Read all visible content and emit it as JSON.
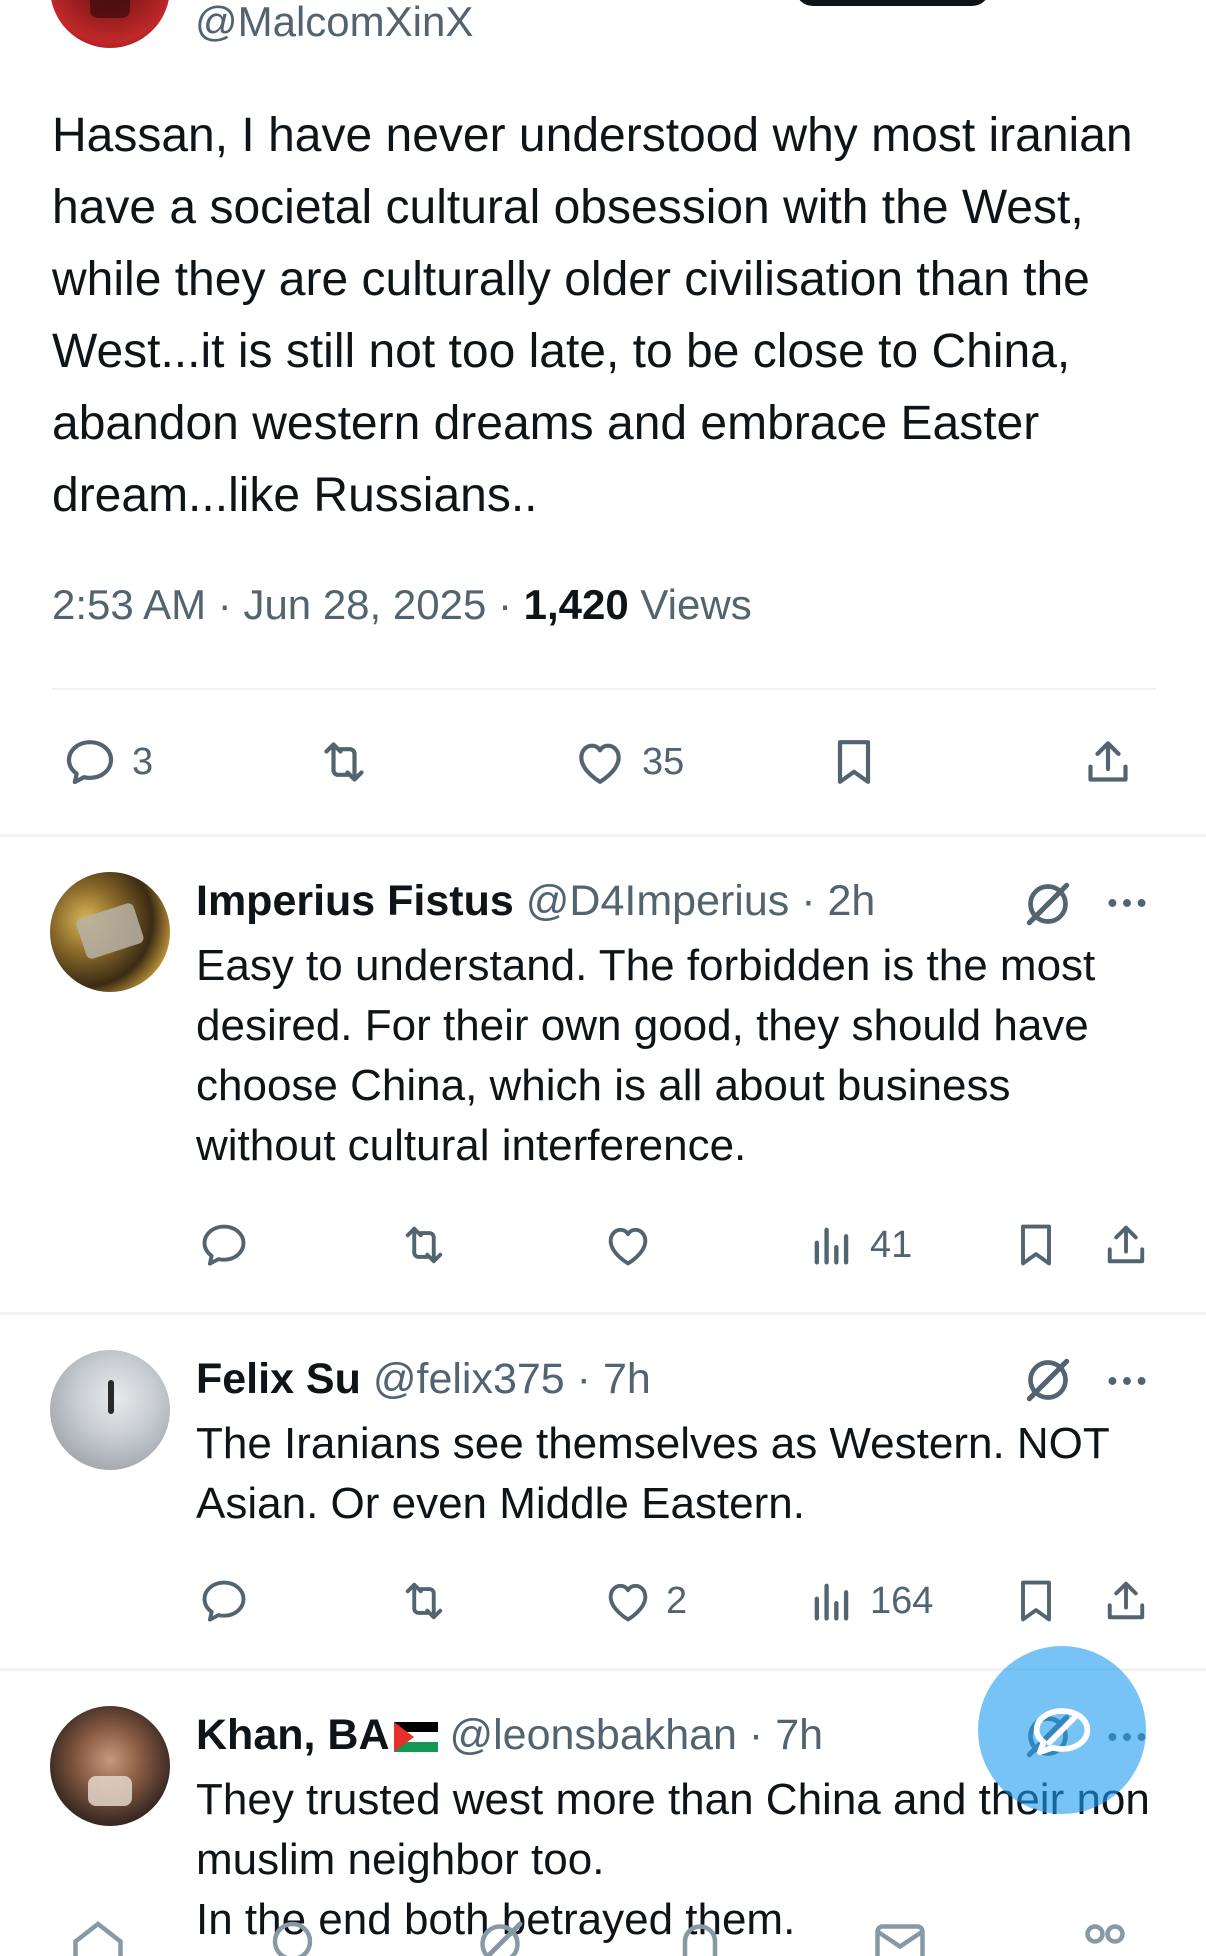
{
  "post": {
    "handle": "@MalcomXinX",
    "text": "Hassan, I have never understood why most iranian have a societal cultural obsession with the West, while they are culturally older civilisation than the West...it is still not too late, to be close to China, abandon western dreams and embrace Easter dream...like Russians..",
    "time": "2:53 AM",
    "date": "Jun 28, 2025",
    "views_count": "1,420",
    "views_label": "Views",
    "replies": "3",
    "likes": "35"
  },
  "replies": [
    {
      "name": "Imperius Fistus",
      "handle": "@D4Imperius",
      "age": "2h",
      "text": "Easy to understand. The forbidden is the most desired. For their own good, they should have choose China, which is all about business without cultural interference.",
      "likes": "",
      "views": "41"
    },
    {
      "name": "Felix Su",
      "handle": "@felix375",
      "age": "7h",
      "text": "The Iranians see themselves as Western. NOT Asian. Or even Middle Eastern.",
      "likes": "2",
      "views": "164"
    },
    {
      "name": "Khan, BA",
      "handle": "@leonsbakhan",
      "age": "7h",
      "text_line1": "They trusted  west more than China and their non muslim neighbor too.",
      "text_line2": "In the end both betrayed them."
    }
  ],
  "colors": {
    "primary_text": "#0f1419",
    "secondary_text": "#536471",
    "divider": "#eff3f4",
    "accent": "#1d9bf0"
  },
  "icons": [
    "reply-icon",
    "retweet-icon",
    "like-icon",
    "bookmark-icon",
    "share-icon",
    "views-icon",
    "grok-icon",
    "more-icon",
    "compose-icon",
    "home-icon",
    "search-icon",
    "mail-icon"
  ]
}
